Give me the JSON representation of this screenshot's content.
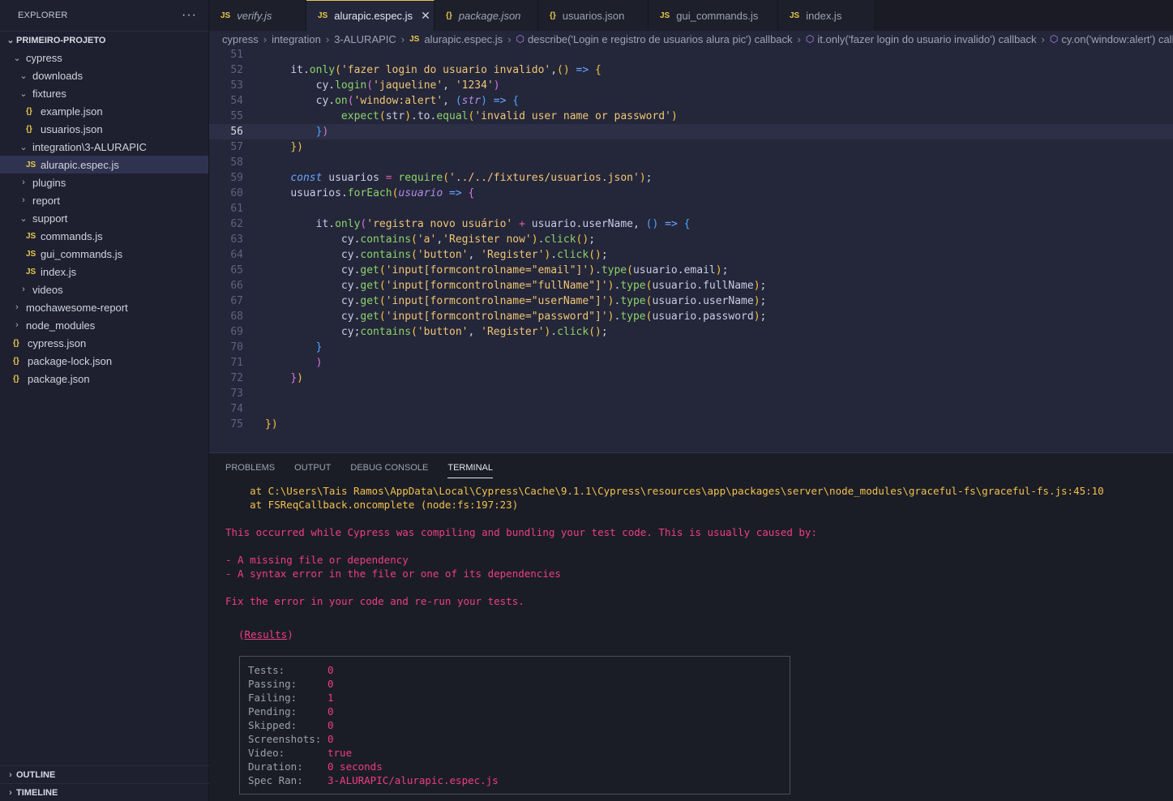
{
  "sidebar": {
    "title": "EXPLORER",
    "more": "···",
    "project": "PRIMEIRO-PROJETO",
    "tree": [
      {
        "label": "cypress",
        "type": "folder-open",
        "indent": 1
      },
      {
        "label": "downloads",
        "type": "folder-open",
        "indent": 2
      },
      {
        "label": "fixtures",
        "type": "folder-open",
        "indent": 2
      },
      {
        "label": "example.json",
        "type": "json",
        "indent": 3
      },
      {
        "label": "usuarios.json",
        "type": "json",
        "indent": 3
      },
      {
        "label": "integration\\3-ALURAPIC",
        "type": "folder-open",
        "indent": 2
      },
      {
        "label": "alurapic.espec.js",
        "type": "js",
        "indent": 3,
        "selected": true
      },
      {
        "label": "plugins",
        "type": "folder-closed",
        "indent": 2
      },
      {
        "label": "report",
        "type": "folder-closed",
        "indent": 2
      },
      {
        "label": "support",
        "type": "folder-open",
        "indent": 2
      },
      {
        "label": "commands.js",
        "type": "js",
        "indent": 3
      },
      {
        "label": "gui_commands.js",
        "type": "js",
        "indent": 3
      },
      {
        "label": "index.js",
        "type": "js",
        "indent": 3
      },
      {
        "label": "videos",
        "type": "folder-closed",
        "indent": 2
      },
      {
        "label": "mochawesome-report",
        "type": "folder-closed",
        "indent": 1
      },
      {
        "label": "node_modules",
        "type": "folder-closed",
        "indent": 1
      },
      {
        "label": "cypress.json",
        "type": "json",
        "indent": 1
      },
      {
        "label": "package-lock.json",
        "type": "json",
        "indent": 1
      },
      {
        "label": "package.json",
        "type": "json",
        "indent": 1
      }
    ],
    "outline": "OUTLINE",
    "timeline": "TIMELINE"
  },
  "tabs": [
    {
      "label": "verify.js",
      "icon": "JS",
      "active": false,
      "italic": true
    },
    {
      "label": "alurapic.espec.js",
      "icon": "JS",
      "active": true,
      "italic": false,
      "close": "✕"
    },
    {
      "label": "package.json",
      "icon": "{}",
      "active": false,
      "italic": true
    },
    {
      "label": "usuarios.json",
      "icon": "{}",
      "active": false,
      "italic": false
    },
    {
      "label": "gui_commands.js",
      "icon": "JS",
      "active": false,
      "italic": false
    },
    {
      "label": "index.js",
      "icon": "JS",
      "active": false,
      "italic": false
    }
  ],
  "breadcrumb": [
    "cypress",
    "integration",
    "3-ALURAPIC",
    "alurapic.espec.js",
    "describe('Login e registro de usuarios alura pic') callback",
    "it.only('fazer login do usuario invalido') callback",
    "cy.on('window:alert') callback"
  ],
  "editor": {
    "current_line": 56,
    "lines": [
      {
        "n": "51",
        "html": ""
      },
      {
        "n": "52",
        "html": "    <span class='tok-var'>it</span>.<span class='tok-fn'>only</span><span class='tok-b1'>(</span><span class='tok-str'>'fazer login do usuario invalido'</span>,<span class='tok-b1'>()</span> <span class='tok-kw'>=></span> <span class='tok-b1'>{</span>"
      },
      {
        "n": "53",
        "html": "        <span class='tok-var'>cy</span>.<span class='tok-fn'>login</span><span class='tok-b2'>(</span><span class='tok-str'>'jaqueline'</span>, <span class='tok-str'>'1234'</span><span class='tok-b2'>)</span>"
      },
      {
        "n": "54",
        "html": "        <span class='tok-var'>cy</span>.<span class='tok-fn'>on</span><span class='tok-b2'>(</span><span class='tok-str'>'window:alert'</span>, <span class='tok-b3'>(</span><span class='tok-par'>str</span><span class='tok-b3'>)</span> <span class='tok-kw'>=></span> <span class='tok-b3'>{</span>"
      },
      {
        "n": "55",
        "html": "            <span class='tok-fn'>expect</span><span class='tok-b1'>(</span><span class='tok-var'>str</span><span class='tok-b1'>)</span>.<span class='tok-var'>to</span>.<span class='tok-fn'>equal</span><span class='tok-b1'>(</span><span class='tok-str'>'invalid user name or password'</span><span class='tok-b1'>)</span>"
      },
      {
        "n": "56",
        "html": "        <span class='tok-b3'>}</span><span class='tok-b2'>)</span>"
      },
      {
        "n": "57",
        "html": "    <span class='tok-b1'>})</span>"
      },
      {
        "n": "58",
        "html": ""
      },
      {
        "n": "59",
        "html": "    <span class='tok-kw'>const</span> <span class='tok-var'>usuarios</span> <span class='tok-op'>=</span> <span class='tok-fn'>require</span><span class='tok-b1'>(</span><span class='tok-str'>'../../fixtures/usuarios.json'</span><span class='tok-b1'>)</span>;"
      },
      {
        "n": "60",
        "html": "    <span class='tok-var'>usuarios</span>.<span class='tok-fn'>forEach</span><span class='tok-b1'>(</span><span class='tok-par'>usuario</span> <span class='tok-kw'>=></span> <span class='tok-b2'>{</span>"
      },
      {
        "n": "61",
        "html": ""
      },
      {
        "n": "62",
        "html": "        <span class='tok-var'>it</span>.<span class='tok-fn'>only</span><span class='tok-b2'>(</span><span class='tok-str'>'registra novo usuário'</span> <span class='tok-op'>+</span> <span class='tok-var'>usuario</span>.<span class='tok-var'>userName</span>, <span class='tok-b3'>()</span> <span class='tok-kw'>=></span> <span class='tok-b3'>{</span>"
      },
      {
        "n": "63",
        "html": "            <span class='tok-var'>cy</span>.<span class='tok-fn'>contains</span><span class='tok-b1'>(</span><span class='tok-str'>'a'</span>,<span class='tok-str'>'Register now'</span><span class='tok-b1'>)</span>.<span class='tok-fn'>click</span><span class='tok-b1'>()</span>;"
      },
      {
        "n": "64",
        "html": "            <span class='tok-var'>cy</span>.<span class='tok-fn'>contains</span><span class='tok-b1'>(</span><span class='tok-str'>'button'</span>, <span class='tok-str'>'Register'</span><span class='tok-b1'>)</span>.<span class='tok-fn'>click</span><span class='tok-b1'>()</span>;"
      },
      {
        "n": "65",
        "html": "            <span class='tok-var'>cy</span>.<span class='tok-fn'>get</span><span class='tok-b1'>(</span><span class='tok-str'>'input[formcontrolname=\"email\"]'</span><span class='tok-b1'>)</span>.<span class='tok-fn'>type</span><span class='tok-b1'>(</span><span class='tok-var'>usuario</span>.<span class='tok-var'>email</span><span class='tok-b1'>)</span>;"
      },
      {
        "n": "66",
        "html": "            <span class='tok-var'>cy</span>.<span class='tok-fn'>get</span><span class='tok-b1'>(</span><span class='tok-str'>'input[formcontrolname=\"fullName\"]'</span><span class='tok-b1'>)</span>.<span class='tok-fn'>type</span><span class='tok-b1'>(</span><span class='tok-var'>usuario</span>.<span class='tok-var'>fullName</span><span class='tok-b1'>)</span>;"
      },
      {
        "n": "67",
        "html": "            <span class='tok-var'>cy</span>.<span class='tok-fn'>get</span><span class='tok-b1'>(</span><span class='tok-str'>'input[formcontrolname=\"userName\"]'</span><span class='tok-b1'>)</span>.<span class='tok-fn'>type</span><span class='tok-b1'>(</span><span class='tok-var'>usuario</span>.<span class='tok-var'>userName</span><span class='tok-b1'>)</span>;"
      },
      {
        "n": "68",
        "html": "            <span class='tok-var'>cy</span>.<span class='tok-fn'>get</span><span class='tok-b1'>(</span><span class='tok-str'>'input[formcontrolname=\"password\"]'</span><span class='tok-b1'>)</span>.<span class='tok-fn'>type</span><span class='tok-b1'>(</span><span class='tok-var'>usuario</span>.<span class='tok-var'>password</span><span class='tok-b1'>)</span>;"
      },
      {
        "n": "69",
        "html": "            <span class='tok-var'>cy</span>;<span class='tok-fn'>contains</span><span class='tok-b1'>(</span><span class='tok-str'>'button'</span>, <span class='tok-str'>'Register'</span><span class='tok-b1'>)</span>.<span class='tok-fn'>click</span><span class='tok-b1'>()</span>;"
      },
      {
        "n": "70",
        "html": "        <span class='tok-b3'>}</span>"
      },
      {
        "n": "71",
        "html": "        <span class='tok-b2'>)</span>"
      },
      {
        "n": "72",
        "html": "    <span class='tok-b2'>}</span><span class='tok-b1'>)</span>"
      },
      {
        "n": "73",
        "html": ""
      },
      {
        "n": "74",
        "html": ""
      },
      {
        "n": "75",
        "html": "<span class='tok-b1'>})</span>"
      }
    ]
  },
  "panel": {
    "tabs": [
      "PROBLEMS",
      "OUTPUT",
      "DEBUG CONSOLE",
      "TERMINAL"
    ],
    "active_tab": "TERMINAL",
    "terminal": {
      "stack1": "    at C:\\Users\\Tais Ramos\\AppData\\Local\\Cypress\\Cache\\9.1.1\\Cypress\\resources\\app\\packages\\server\\node_modules\\graceful-fs\\graceful-fs.js:45:10",
      "stack2": "    at FSReqCallback.oncomplete (node:fs:197:23)",
      "msg1": "This occurred while Cypress was compiling and bundling your test code. This is usually caused by:",
      "bullet1": "- A missing file or dependency",
      "bullet2": "- A syntax error in the file or one of its dependencies",
      "msg2": "Fix the error in your code and re-run your tests.",
      "results_title": "Results",
      "results": [
        {
          "key": "Tests:",
          "value": "0"
        },
        {
          "key": "Passing:",
          "value": "0"
        },
        {
          "key": "Failing:",
          "value": "1"
        },
        {
          "key": "Pending:",
          "value": "0"
        },
        {
          "key": "Skipped:",
          "value": "0"
        },
        {
          "key": "Screenshots:",
          "value": "0"
        },
        {
          "key": "Video:",
          "value": "true"
        },
        {
          "key": "Duration:",
          "value": "0 seconds"
        },
        {
          "key": "Spec Ran:",
          "value": "3-ALURAPIC/alurapic.espec.js"
        }
      ]
    }
  }
}
